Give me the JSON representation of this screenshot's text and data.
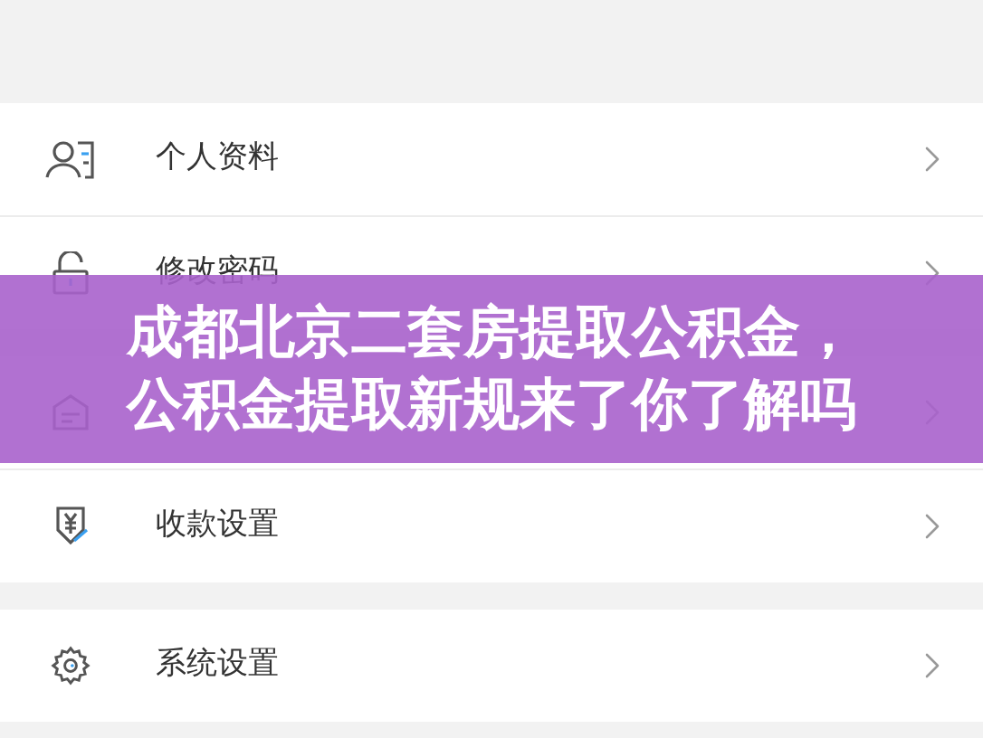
{
  "menu_groups": [
    {
      "items": [
        {
          "kind": "profile",
          "label": "个人资料"
        },
        {
          "kind": "lock",
          "label": "修改密码"
        }
      ]
    },
    {
      "items": [
        {
          "kind": "card"
        },
        {
          "kind": "yen",
          "label": "收款设置"
        }
      ]
    },
    {
      "items": [
        {
          "kind": "gear",
          "label": "系统设置"
        }
      ]
    }
  ],
  "banner": {
    "lines": [
      "成都北京二套房提取公积金，",
      "公积金提取新规来了你了解吗"
    ]
  }
}
